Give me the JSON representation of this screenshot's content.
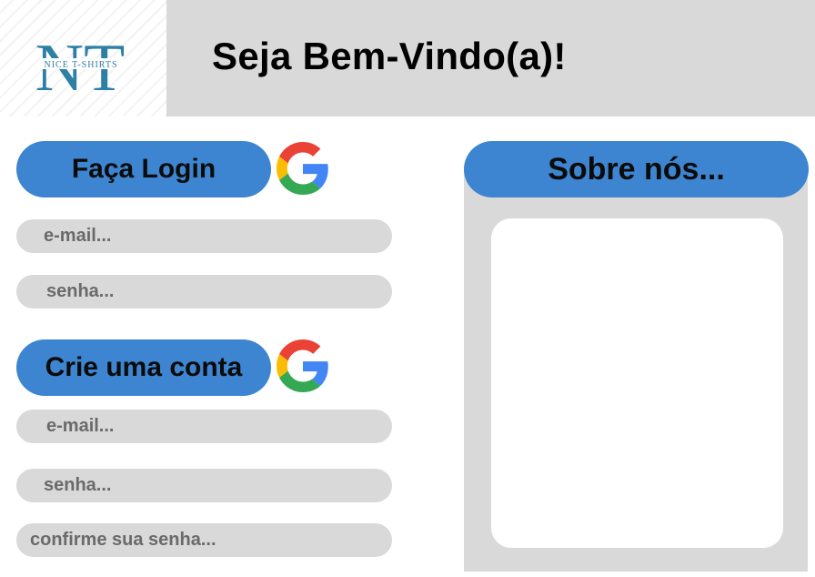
{
  "logo": {
    "monogram": "NT",
    "tagline": "NICE T-SHIRTS",
    "color": "#2e7fa5"
  },
  "header": {
    "title": "Seja Bem-Vindo(a)!"
  },
  "login": {
    "button_label": "Faça Login",
    "email_placeholder": "e-mail...",
    "password_placeholder": "senha...",
    "provider_icon": "google-icon"
  },
  "signup": {
    "button_label": "Crie uma conta",
    "email_placeholder": "e-mail...",
    "password_placeholder": "senha...",
    "confirm_placeholder": "confirme sua senha...",
    "provider_icon": "google-icon"
  },
  "about": {
    "title": "Sobre nós..."
  },
  "colors": {
    "accent": "#3d85d0",
    "panel": "#d9d9d9",
    "background": "#ffffff"
  }
}
